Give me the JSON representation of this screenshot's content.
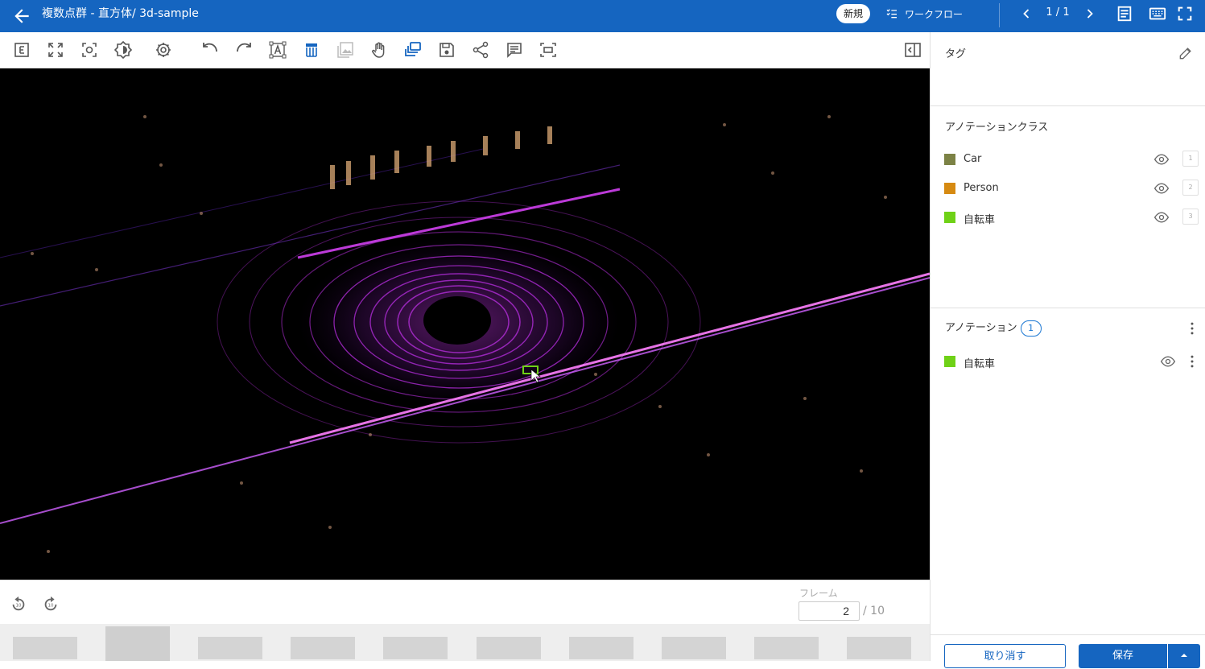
{
  "header": {
    "title": "複数点群 - 直方体/ 3d-sample",
    "badge": "新規",
    "workflow_label": "ワークフロー",
    "pager": "1 / 1"
  },
  "toolbar": {
    "icons": [
      "label-e-icon",
      "fit-view-icon",
      "focus-icon",
      "brightness-icon",
      "settings-icon",
      "undo-icon",
      "redo-icon",
      "text-box-icon",
      "ruler-icon",
      "image-icon",
      "hand-icon",
      "layers-icon",
      "save-icon",
      "share-icon",
      "comment-icon",
      "screenshot-icon"
    ],
    "panel_toggle_icon": "panel-toggle-icon"
  },
  "player": {
    "frame_label": "フレーム",
    "frame_value": "2",
    "frame_total": "/ 10",
    "thumbnail_count": 10,
    "active_thumbnail": 2
  },
  "panel": {
    "tags_title": "タグ",
    "classes_title": "アノテーションクラス",
    "classes": [
      {
        "name": "Car",
        "color": "#7c8245",
        "key": "1"
      },
      {
        "name": "Person",
        "color": "#d68a12",
        "key": "2"
      },
      {
        "name": "自転車",
        "color": "#6fd117",
        "key": "3"
      }
    ],
    "annotations_title": "アノテーション",
    "annotations_count": "1",
    "annotations": [
      {
        "name": "自転車",
        "color": "#6fd117"
      }
    ],
    "cancel_label": "取り消す",
    "save_label": "保存"
  },
  "colors": {
    "primary": "#1565c0",
    "point_cloud": "#d040f0",
    "background": "#000000"
  }
}
